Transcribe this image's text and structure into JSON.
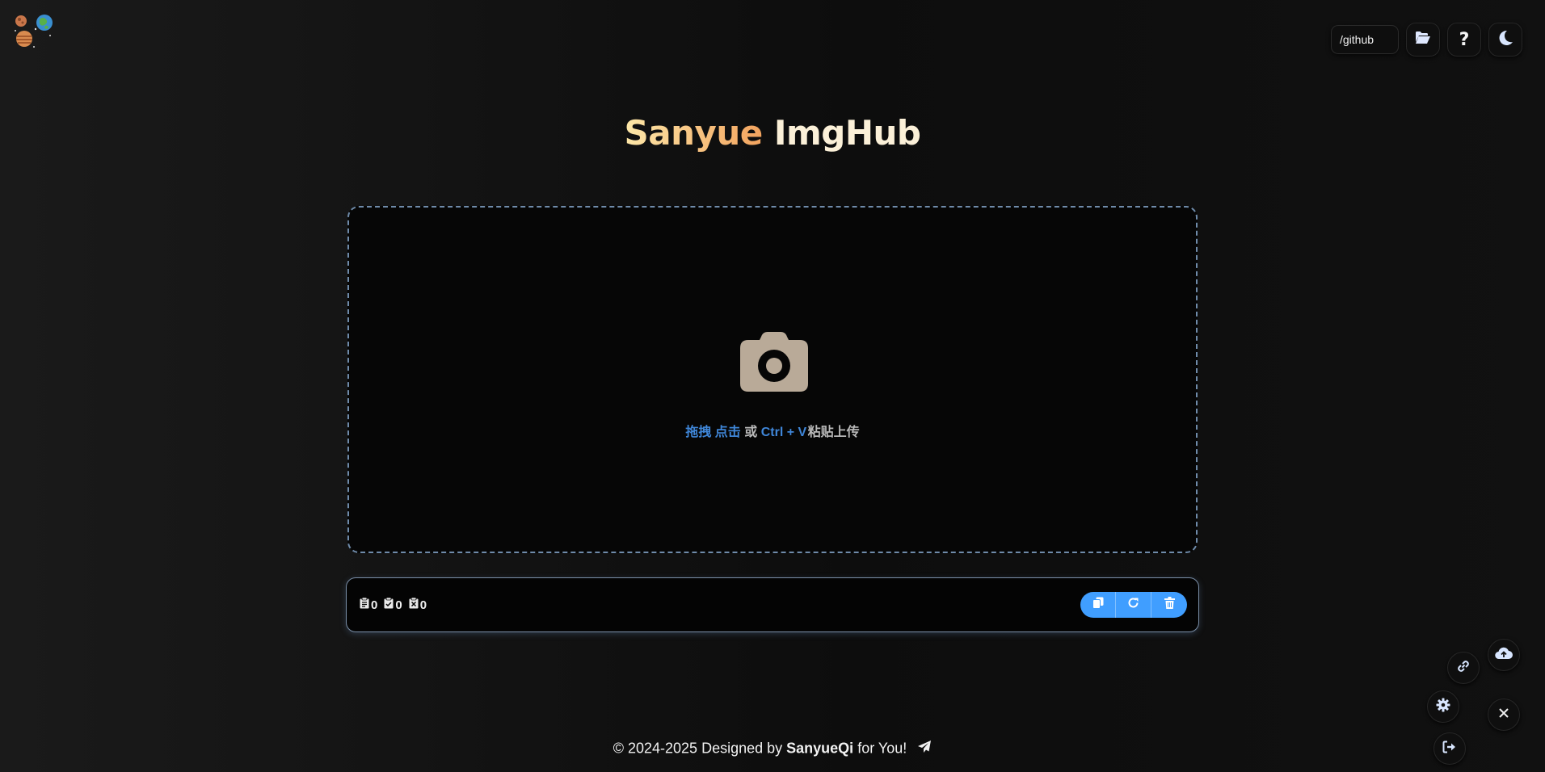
{
  "header": {
    "logo_icon": "planets-logo-icon",
    "path_input_value": "/github",
    "buttons": [
      {
        "name": "folder-open-button",
        "icon": "folder-open-icon"
      },
      {
        "name": "help-button",
        "icon": "question-icon",
        "label": "?"
      },
      {
        "name": "theme-toggle-button",
        "icon": "moon-icon"
      }
    ]
  },
  "title": {
    "part1": "Sanyue",
    "part2": "ImgHub"
  },
  "dropzone": {
    "icon": "camera-icon",
    "hint_drag": "拖拽",
    "hint_click": "点击",
    "hint_or": "或",
    "hint_shortcut": "Ctrl + V",
    "hint_paste": "粘贴上传"
  },
  "status": {
    "counts": [
      {
        "icon": "clipboard-list-icon",
        "value": "0"
      },
      {
        "icon": "clipboard-check-icon",
        "value": "0"
      },
      {
        "icon": "clipboard-x-icon",
        "value": "0"
      }
    ],
    "actions": [
      {
        "name": "copy-all-button",
        "icon": "copy-icon"
      },
      {
        "name": "retry-button",
        "icon": "refresh-icon"
      },
      {
        "name": "clear-button",
        "icon": "trash-icon"
      }
    ]
  },
  "footer": {
    "prefix": "© 2024-2025 Designed by",
    "author": "SanyueQi",
    "suffix": "for You!",
    "icon": "paper-plane-icon"
  },
  "fab_menu": [
    {
      "name": "upload-method-button",
      "icon": "cloud-upload-icon"
    },
    {
      "name": "link-format-button",
      "icon": "link-icon"
    },
    {
      "name": "settings-button",
      "icon": "gear-icon"
    },
    {
      "name": "close-menu-button",
      "icon": "close-icon"
    },
    {
      "name": "logout-button",
      "icon": "logout-icon"
    }
  ],
  "colors": {
    "accent": "#409eff",
    "hint_blue": "#3f86d8",
    "camera": "#b9aa98",
    "title_gradient_start": "#fde7a8",
    "title_gradient_end": "#f2a35e",
    "dropzone_border": "#6f8baa"
  }
}
